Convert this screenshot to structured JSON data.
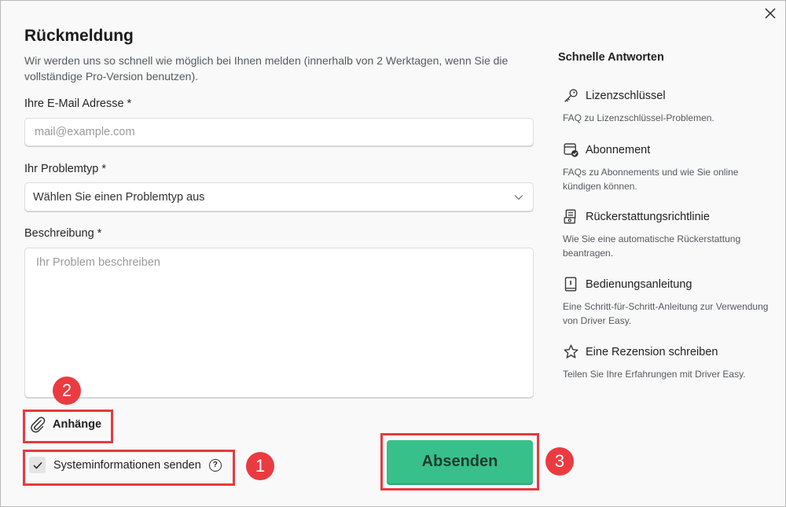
{
  "dialog": {
    "title": "Rückmeldung",
    "subtitle": "Wir werden uns so schnell wie möglich bei Ihnen melden (innerhalb von 2 Werktagen, wenn Sie die vollständige Pro-Version benutzen).",
    "close_icon": "close-icon"
  },
  "form": {
    "email_label": "Ihre E-Mail Adresse *",
    "email_placeholder": "mail@example.com",
    "email_value": "",
    "problem_label": "Ihr Problemtyp *",
    "problem_selected": "Wählen Sie einen Problemtyp aus",
    "description_label": "Beschreibung *",
    "description_placeholder": "Ihr Problem beschreiben",
    "description_value": "",
    "attachments_label": "Anhänge",
    "sysinfo_label": "Systeminformationen senden",
    "sysinfo_checked": true,
    "help_glyph": "?",
    "submit_label": "Absenden"
  },
  "annotations": {
    "marker_1": "1",
    "marker_2": "2",
    "marker_3": "3",
    "color": "#e8393f"
  },
  "quick_answers": {
    "heading": "Schnelle Antworten",
    "items": [
      {
        "icon": "key-icon",
        "title": "Lizenzschlüssel",
        "desc": "FAQ zu Lizenzschlüssel-Problemen."
      },
      {
        "icon": "subscription-icon",
        "title": "Abonnement",
        "desc": "FAQs zu Abonnements und wie Sie online kündigen können."
      },
      {
        "icon": "refund-icon",
        "title": "Rückerstattungsrichtlinie",
        "desc": "Wie Sie eine automatische Rückerstattung beantragen."
      },
      {
        "icon": "manual-icon",
        "title": "Bedienungsanleitung",
        "desc": "Eine Schritt-für-Schritt-Anleitung zur Verwendung von Driver Easy."
      },
      {
        "icon": "star-icon",
        "title": "Eine Rezension schreiben",
        "desc": "Teilen Sie Ihre Erfahrungen mit Driver Easy."
      }
    ]
  },
  "colors": {
    "accent": "#38c08a",
    "annotation": "#e8393f"
  }
}
